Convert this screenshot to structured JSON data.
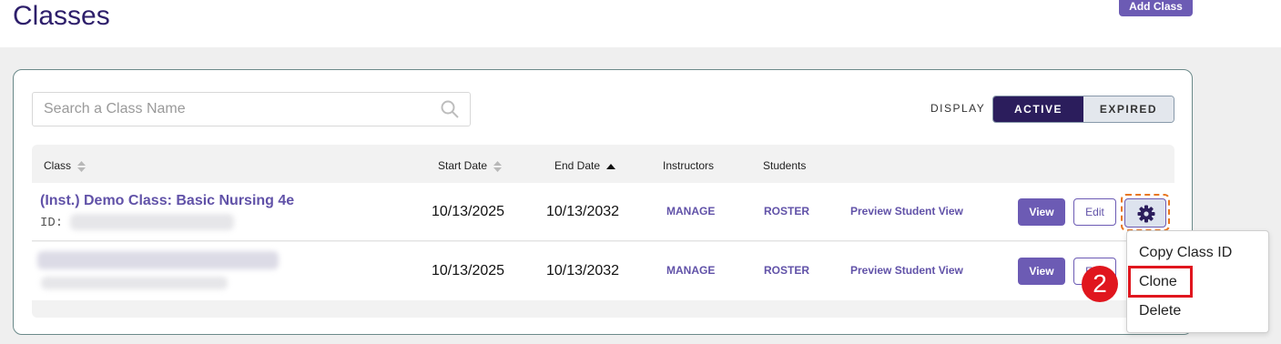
{
  "header": {
    "title": "Classes",
    "add_class_label": "Add Class"
  },
  "search": {
    "placeholder": "Search a Class Name",
    "value": ""
  },
  "display": {
    "label": "DISPLAY",
    "active_label": "ACTIVE",
    "expired_label": "EXPIRED",
    "selected": "ACTIVE"
  },
  "table": {
    "columns": {
      "class": "Class",
      "start_date": "Start Date",
      "end_date": "End Date",
      "instructors": "Instructors",
      "students": "Students"
    },
    "rows": [
      {
        "class_name": "(Inst.) Demo Class: Basic Nursing 4e",
        "id_label": "ID:",
        "start_date": "10/13/2025",
        "end_date": "10/13/2032",
        "instructors_link": "MANAGE",
        "students_link": "ROSTER",
        "preview_link": "Preview Student View",
        "view_label": "View",
        "edit_label": "Edit"
      },
      {
        "class_name": "",
        "id_label": "",
        "start_date": "10/13/2025",
        "end_date": "10/13/2032",
        "instructors_link": "MANAGE",
        "students_link": "ROSTER",
        "preview_link": "Preview Student View",
        "view_label": "View",
        "edit_label": "Edit"
      }
    ]
  },
  "context_menu": {
    "items": [
      "Copy Class ID",
      "Clone",
      "Delete"
    ],
    "highlighted": "Clone"
  },
  "annotation": {
    "step_number": "2"
  },
  "colors": {
    "brand_purple": "#6c5bb4",
    "dark_purple": "#2b1d5c",
    "highlight_red": "#e0161e",
    "focus_orange": "#e87722"
  }
}
